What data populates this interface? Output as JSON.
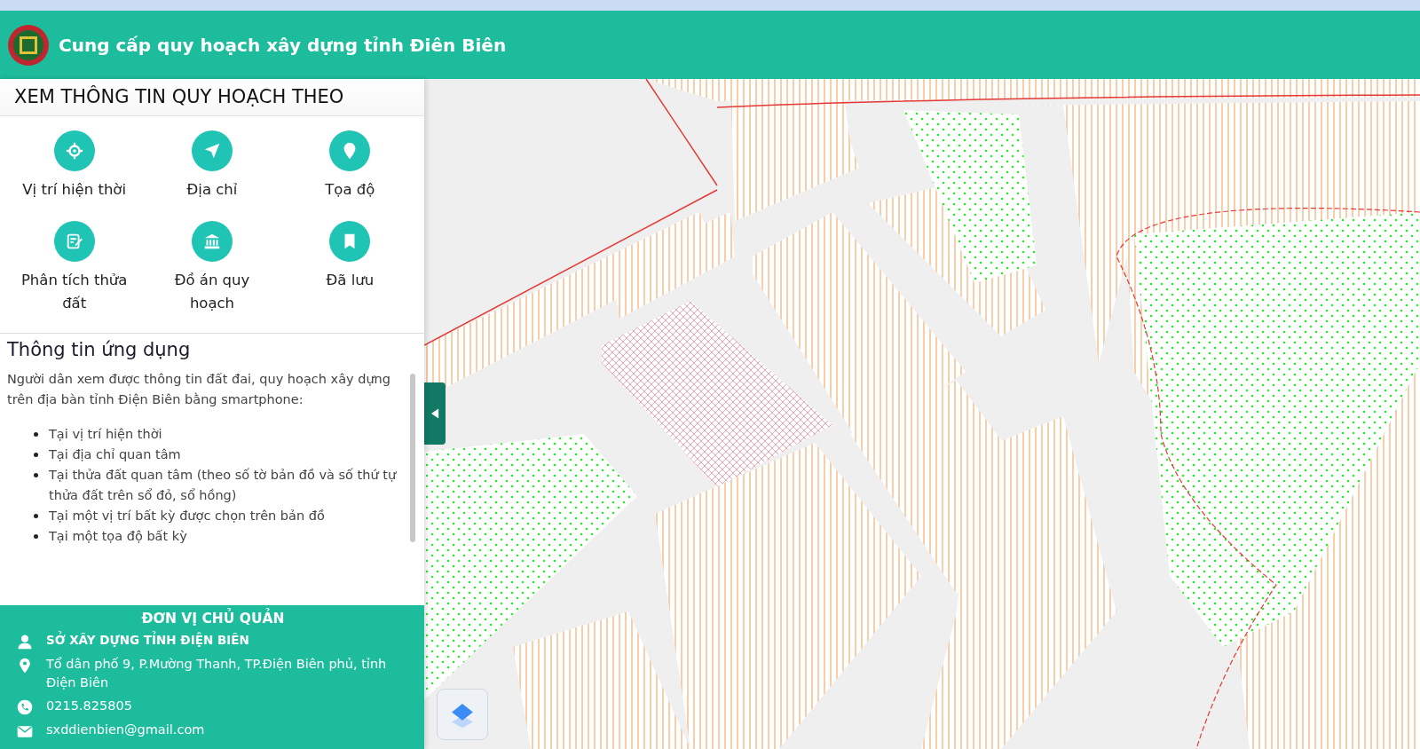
{
  "header": {
    "title": "Cung cấp quy hoạch xây dựng tỉnh Điên Biên"
  },
  "sidebar": {
    "heading": "XEM THÔNG TIN QUY HOẠCH THEO",
    "options": [
      {
        "label": "Vị trí hiện thời"
      },
      {
        "label": "Địa chỉ"
      },
      {
        "label": "Tọa độ"
      },
      {
        "label": "Phân tích thửa đất"
      },
      {
        "label": "Đồ án quy hoạch"
      },
      {
        "label": "Đã lưu"
      }
    ],
    "info": {
      "title": "Thông tin ứng dụng",
      "intro": "Người dân xem được thông tin đất đai, quy hoạch xây dựng trên địa bàn tỉnh Điện Biên bằng smartphone:",
      "items": [
        "Tại vị trí hiện thời",
        "Tại địa chỉ quan tâm",
        "Tại thửa đất quan tâm (theo số tờ bản đồ và số thứ tự thửa đất trên sổ đỏ, sổ hồng)",
        "Tại một vị trí bất kỳ được chọn trên bản đồ",
        "Tại một tọa độ bất kỳ"
      ]
    },
    "footer": {
      "title": "ĐƠN VỊ CHỦ QUẢN",
      "contacts": [
        {
          "kind": "organization",
          "text": "SỞ XÂY DỰNG TỈNH ĐIỆN BIÊN"
        },
        {
          "kind": "address",
          "text": "Tổ dân phố 9, P.Mường Thanh, TP.Điện Biên phủ, tỉnh Điện Biên"
        },
        {
          "kind": "phone",
          "text": "0215.825805"
        },
        {
          "kind": "email",
          "text": "sxddienbien@gmail.com"
        }
      ]
    }
  }
}
